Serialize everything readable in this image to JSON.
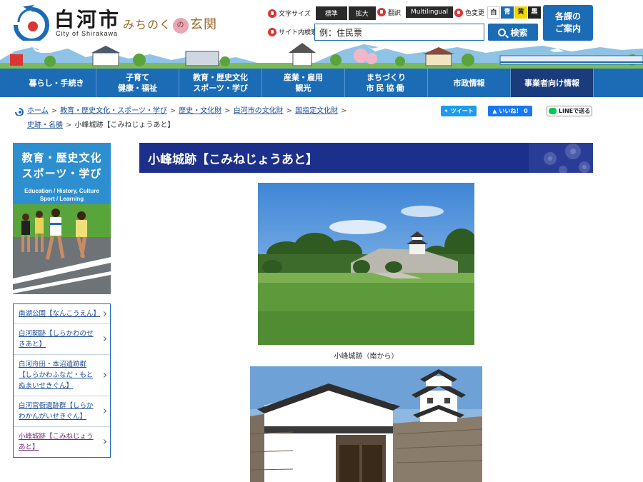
{
  "header": {
    "logo_title": "白河市",
    "logo_sub": "City of Shirakawa",
    "slogan_left": "みちのく",
    "slogan_mark": "の",
    "slogan_right": "玄関",
    "font_size_label": "文字サイズ",
    "font_standard": "標準",
    "font_large": "拡大",
    "translate_label": "翻訳",
    "translate_btn": "Multilingual",
    "color_label": "色変更",
    "colors": [
      {
        "label": "白",
        "bg": "#ffffff",
        "fg": "#222222"
      },
      {
        "label": "青",
        "bg": "#1c6cb5",
        "fg": "#ffffff"
      },
      {
        "label": "黄",
        "bg": "#f2d600",
        "fg": "#222222"
      },
      {
        "label": "黒",
        "bg": "#222222",
        "fg": "#ffffff"
      }
    ],
    "search_label": "サイト内検索",
    "search_placeholder": "例：住民票",
    "search_btn": "検索",
    "guide_line1": "各課の",
    "guide_line2": "ご案内"
  },
  "nav": [
    {
      "line1": "暮らし・手続き",
      "line2": ""
    },
    {
      "line1": "子育て",
      "line2": "健康・福祉"
    },
    {
      "line1": "教育・歴史文化",
      "line2": "スポーツ・学び"
    },
    {
      "line1": "産業・雇用",
      "line2": "観光"
    },
    {
      "line1": "まちづくり",
      "line2": "市民協働"
    },
    {
      "line1": "市政情報",
      "line2": ""
    },
    {
      "line1": "事業者向け情報",
      "line2": ""
    }
  ],
  "breadcrumb": {
    "items": [
      "ホーム",
      "教育・歴史文化・スポーツ・学び",
      "歴史・文化財",
      "白河市の文化財",
      "国指定文化財",
      "史跡・名勝"
    ],
    "current": "小峰城跡【こみねじょうあと】",
    "sep": ">"
  },
  "share": {
    "tweet": "ツイート",
    "like": "いいね！ 0",
    "line": "LINEで送る"
  },
  "sidebar": {
    "banner_jp_line1": "教育・歴史文化",
    "banner_jp_line2": "スポーツ・学び",
    "banner_en_line1": "Education / History, Culture",
    "banner_en_line2": "Sport / Learning",
    "links": [
      "南湖公園【なんこうえん】",
      "白河関跡【しらかわのせきあと】",
      "白河舟田・本沼遺跡群【しらかわふなだ・もとぬまいせきぐん】",
      "白河官衙遺跡群【しらかわかんがいせきぐん】",
      "小峰城跡【こみねじょうあと】"
    ]
  },
  "main": {
    "title": "小峰城跡【こみねじょうあと】",
    "caption1": "小峰城跡（南から）"
  }
}
